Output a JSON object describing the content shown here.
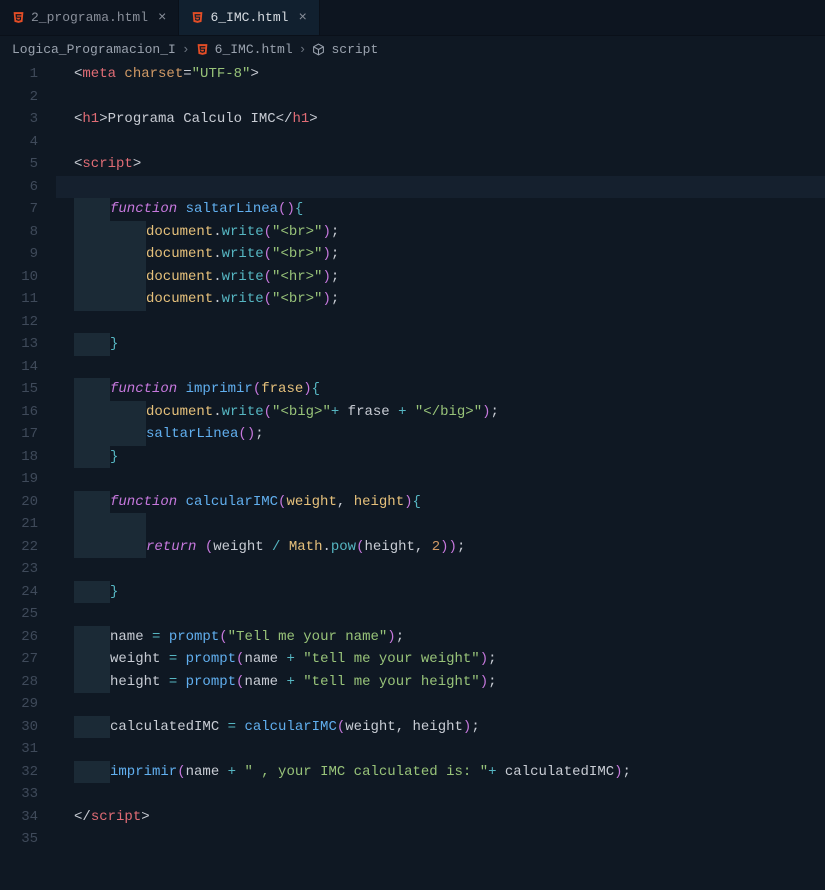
{
  "tabs": [
    {
      "label": "2_programa.html",
      "active": false
    },
    {
      "label": "6_IMC.html",
      "active": true
    }
  ],
  "breadcrumb": {
    "folder": "Logica_Programacion_I",
    "file": "6_IMC.html",
    "symbol": "script"
  },
  "lineCount": 35,
  "code": {
    "l1": [
      [
        "c-punct",
        "<"
      ],
      [
        "c-tag",
        "meta"
      ],
      [
        "c-txt",
        " "
      ],
      [
        "c-attr",
        "charset"
      ],
      [
        "c-punct",
        "="
      ],
      [
        "c-str",
        "\"UTF-8\""
      ],
      [
        "c-punct",
        ">"
      ]
    ],
    "l2": [],
    "l3": [
      [
        "c-punct",
        "<"
      ],
      [
        "c-tag",
        "h1"
      ],
      [
        "c-punct",
        ">"
      ],
      [
        "c-txt",
        "Programa Calculo IMC"
      ],
      [
        "c-punct",
        "</"
      ],
      [
        "c-tag",
        "h1"
      ],
      [
        "c-punct",
        ">"
      ]
    ],
    "l4": [],
    "l5": [
      [
        "c-punct",
        "<"
      ],
      [
        "c-tag",
        "script"
      ],
      [
        "c-punct",
        ">"
      ]
    ],
    "l6": [],
    "l7": [
      [
        "c-key",
        "function"
      ],
      [
        "c-txt",
        " "
      ],
      [
        "c-func",
        "saltarLinea"
      ],
      [
        "c-paren",
        "()"
      ],
      [
        "c-brace",
        "{"
      ]
    ],
    "l8": [
      [
        "c-obj",
        "document"
      ],
      [
        "c-punct",
        "."
      ],
      [
        "c-method",
        "write"
      ],
      [
        "c-paren",
        "("
      ],
      [
        "c-str",
        "\"<br>\""
      ],
      [
        "c-paren",
        ")"
      ],
      [
        "c-punct",
        ";"
      ]
    ],
    "l9": [
      [
        "c-obj",
        "document"
      ],
      [
        "c-punct",
        "."
      ],
      [
        "c-method",
        "write"
      ],
      [
        "c-paren",
        "("
      ],
      [
        "c-str",
        "\"<br>\""
      ],
      [
        "c-paren",
        ")"
      ],
      [
        "c-punct",
        ";"
      ]
    ],
    "l10": [
      [
        "c-obj",
        "document"
      ],
      [
        "c-punct",
        "."
      ],
      [
        "c-method",
        "write"
      ],
      [
        "c-paren",
        "("
      ],
      [
        "c-str",
        "\"<hr>\""
      ],
      [
        "c-paren",
        ")"
      ],
      [
        "c-punct",
        ";"
      ]
    ],
    "l11": [
      [
        "c-obj",
        "document"
      ],
      [
        "c-punct",
        "."
      ],
      [
        "c-method",
        "write"
      ],
      [
        "c-paren",
        "("
      ],
      [
        "c-str",
        "\"<br>\""
      ],
      [
        "c-paren",
        ")"
      ],
      [
        "c-punct",
        ";"
      ]
    ],
    "l12": [],
    "l13": [
      [
        "c-brace",
        "}"
      ]
    ],
    "l14": [],
    "l15": [
      [
        "c-key",
        "function"
      ],
      [
        "c-txt",
        " "
      ],
      [
        "c-func",
        "imprimir"
      ],
      [
        "c-paren",
        "("
      ],
      [
        "c-param",
        "frase"
      ],
      [
        "c-paren",
        ")"
      ],
      [
        "c-brace",
        "{"
      ]
    ],
    "l16": [
      [
        "c-obj",
        "document"
      ],
      [
        "c-punct",
        "."
      ],
      [
        "c-method",
        "write"
      ],
      [
        "c-paren",
        "("
      ],
      [
        "c-str",
        "\"<big>\""
      ],
      [
        "c-op",
        "+"
      ],
      [
        "c-txt",
        " frase "
      ],
      [
        "c-op",
        "+"
      ],
      [
        "c-txt",
        " "
      ],
      [
        "c-str",
        "\"</big>\""
      ],
      [
        "c-paren",
        ")"
      ],
      [
        "c-punct",
        ";"
      ]
    ],
    "l17": [
      [
        "c-func",
        "saltarLinea"
      ],
      [
        "c-paren",
        "()"
      ],
      [
        "c-punct",
        ";"
      ]
    ],
    "l18": [
      [
        "c-brace",
        "}"
      ]
    ],
    "l19": [],
    "l20": [
      [
        "c-key",
        "function"
      ],
      [
        "c-txt",
        " "
      ],
      [
        "c-func",
        "calcularIMC"
      ],
      [
        "c-paren",
        "("
      ],
      [
        "c-param",
        "weight"
      ],
      [
        "c-punct",
        ", "
      ],
      [
        "c-param",
        "height"
      ],
      [
        "c-paren",
        ")"
      ],
      [
        "c-brace",
        "{"
      ]
    ],
    "l21": [],
    "l22": [
      [
        "c-key",
        "return"
      ],
      [
        "c-txt",
        " "
      ],
      [
        "c-paren",
        "("
      ],
      [
        "c-txt",
        "weight "
      ],
      [
        "c-op",
        "/"
      ],
      [
        "c-txt",
        " "
      ],
      [
        "c-obj",
        "Math"
      ],
      [
        "c-punct",
        "."
      ],
      [
        "c-method",
        "pow"
      ],
      [
        "c-paren",
        "("
      ],
      [
        "c-txt",
        "height"
      ],
      [
        "c-punct",
        ", "
      ],
      [
        "c-num",
        "2"
      ],
      [
        "c-paren",
        "))"
      ],
      [
        "c-punct",
        ";"
      ]
    ],
    "l23": [],
    "l24": [
      [
        "c-brace",
        "}"
      ]
    ],
    "l25": [],
    "l26": [
      [
        "c-txt",
        "name "
      ],
      [
        "c-op",
        "="
      ],
      [
        "c-txt",
        " "
      ],
      [
        "c-func",
        "prompt"
      ],
      [
        "c-paren",
        "("
      ],
      [
        "c-str",
        "\"Tell me your name\""
      ],
      [
        "c-paren",
        ")"
      ],
      [
        "c-punct",
        ";"
      ]
    ],
    "l27": [
      [
        "c-txt",
        "weight "
      ],
      [
        "c-op",
        "="
      ],
      [
        "c-txt",
        " "
      ],
      [
        "c-func",
        "prompt"
      ],
      [
        "c-paren",
        "("
      ],
      [
        "c-txt",
        "name "
      ],
      [
        "c-op",
        "+"
      ],
      [
        "c-txt",
        " "
      ],
      [
        "c-str",
        "\"tell me your weight\""
      ],
      [
        "c-paren",
        ")"
      ],
      [
        "c-punct",
        ";"
      ]
    ],
    "l28": [
      [
        "c-txt",
        "height "
      ],
      [
        "c-op",
        "="
      ],
      [
        "c-txt",
        " "
      ],
      [
        "c-func",
        "prompt"
      ],
      [
        "c-paren",
        "("
      ],
      [
        "c-txt",
        "name "
      ],
      [
        "c-op",
        "+"
      ],
      [
        "c-txt",
        " "
      ],
      [
        "c-str",
        "\"tell me your height\""
      ],
      [
        "c-paren",
        ")"
      ],
      [
        "c-punct",
        ";"
      ]
    ],
    "l29": [],
    "l30": [
      [
        "c-txt",
        "calculatedIMC "
      ],
      [
        "c-op",
        "="
      ],
      [
        "c-txt",
        " "
      ],
      [
        "c-func",
        "calcularIMC"
      ],
      [
        "c-paren",
        "("
      ],
      [
        "c-txt",
        "weight"
      ],
      [
        "c-punct",
        ", "
      ],
      [
        "c-txt",
        "height"
      ],
      [
        "c-paren",
        ")"
      ],
      [
        "c-punct",
        ";"
      ]
    ],
    "l31": [],
    "l32": [
      [
        "c-func",
        "imprimir"
      ],
      [
        "c-paren",
        "("
      ],
      [
        "c-txt",
        "name "
      ],
      [
        "c-op",
        "+"
      ],
      [
        "c-txt",
        " "
      ],
      [
        "c-str",
        "\" , your IMC calculated is: \""
      ],
      [
        "c-op",
        "+"
      ],
      [
        "c-txt",
        " calculatedIMC"
      ],
      [
        "c-paren",
        ")"
      ],
      [
        "c-punct",
        ";"
      ]
    ],
    "l33": [],
    "l34": [
      [
        "c-punct",
        "</"
      ],
      [
        "c-tag",
        "script"
      ],
      [
        "c-punct",
        ">"
      ]
    ],
    "l35": []
  },
  "indentLevels": {
    "l1": 0,
    "l2": 0,
    "l3": 0,
    "l4": 0,
    "l5": 0,
    "l6": 0,
    "l7": 1,
    "l8": 2,
    "l9": 2,
    "l10": 2,
    "l11": 2,
    "l12": 2,
    "l13": 1,
    "l14": 0,
    "l15": 1,
    "l16": 2,
    "l17": 2,
    "l18": 1,
    "l19": 0,
    "l20": 1,
    "l21": 2,
    "l22": 2,
    "l23": 2,
    "l24": 1,
    "l25": 0,
    "l26": 1,
    "l27": 1,
    "l28": 1,
    "l29": 0,
    "l30": 1,
    "l31": 0,
    "l32": 1,
    "l33": 0,
    "l34": 0,
    "l35": 0
  },
  "indentMarks": {
    "l7": 1,
    "l8": 2,
    "l9": 2,
    "l10": 2,
    "l11": 2,
    "l12": 0,
    "l13": 1,
    "l15": 1,
    "l16": 2,
    "l17": 2,
    "l18": 1,
    "l20": 1,
    "l21": 2,
    "l22": 2,
    "l23": 0,
    "l24": 1,
    "l26": 1,
    "l27": 1,
    "l28": 1,
    "l30": 1,
    "l32": 1
  },
  "currentLine": 6
}
